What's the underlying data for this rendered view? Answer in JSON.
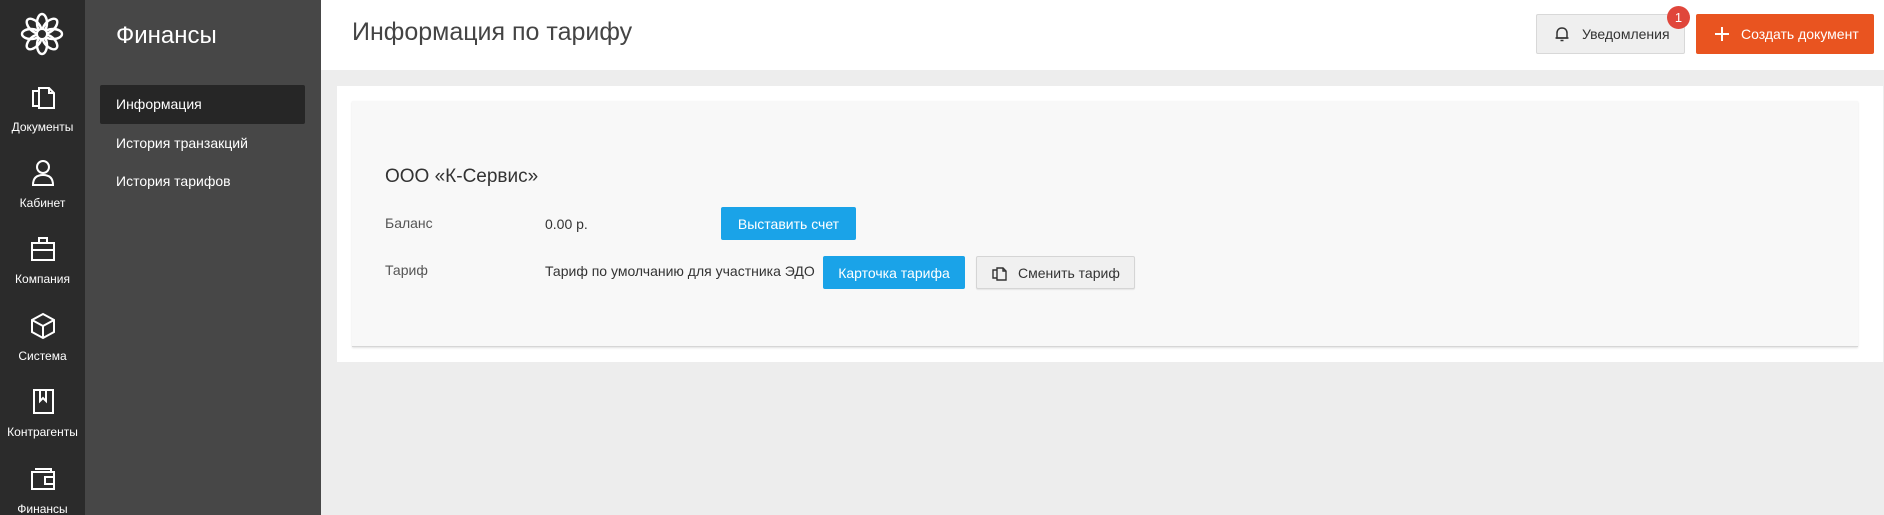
{
  "rail": {
    "items": [
      {
        "label": "Документы",
        "icon": "documents-icon"
      },
      {
        "label": "Кабинет",
        "icon": "user-icon"
      },
      {
        "label": "Компания",
        "icon": "briefcase-icon"
      },
      {
        "label": "Система",
        "icon": "cube-icon"
      },
      {
        "label": "Контрагенты",
        "icon": "bookmark-book-icon"
      },
      {
        "label": "Финансы",
        "icon": "wallet-icon"
      }
    ]
  },
  "sidebar": {
    "title": "Финансы",
    "items": [
      {
        "label": "Информация",
        "active": true
      },
      {
        "label": "История транзакций",
        "active": false
      },
      {
        "label": "История тарифов",
        "active": false
      }
    ]
  },
  "header": {
    "title": "Информация по тарифу",
    "notifications_label": "Уведомления",
    "notifications_count": "1",
    "create_label": "Создать документ"
  },
  "info": {
    "company": "ООО «К-Сервис»",
    "balance_label": "Баланс",
    "balance_value": "0.00 р.",
    "invoice_button": "Выставить счет",
    "tariff_label": "Тариф",
    "tariff_value": "Тариф по умолчанию для участника ЭДО",
    "tariff_card_button": "Карточка тарифа",
    "change_tariff_button": "Сменить тариф"
  },
  "colors": {
    "rail_bg": "#2b2b2b",
    "sidebar_bg": "#474747",
    "accent_orange": "#e95420",
    "accent_blue": "#1aa3e8",
    "badge_red": "#e0463b"
  }
}
